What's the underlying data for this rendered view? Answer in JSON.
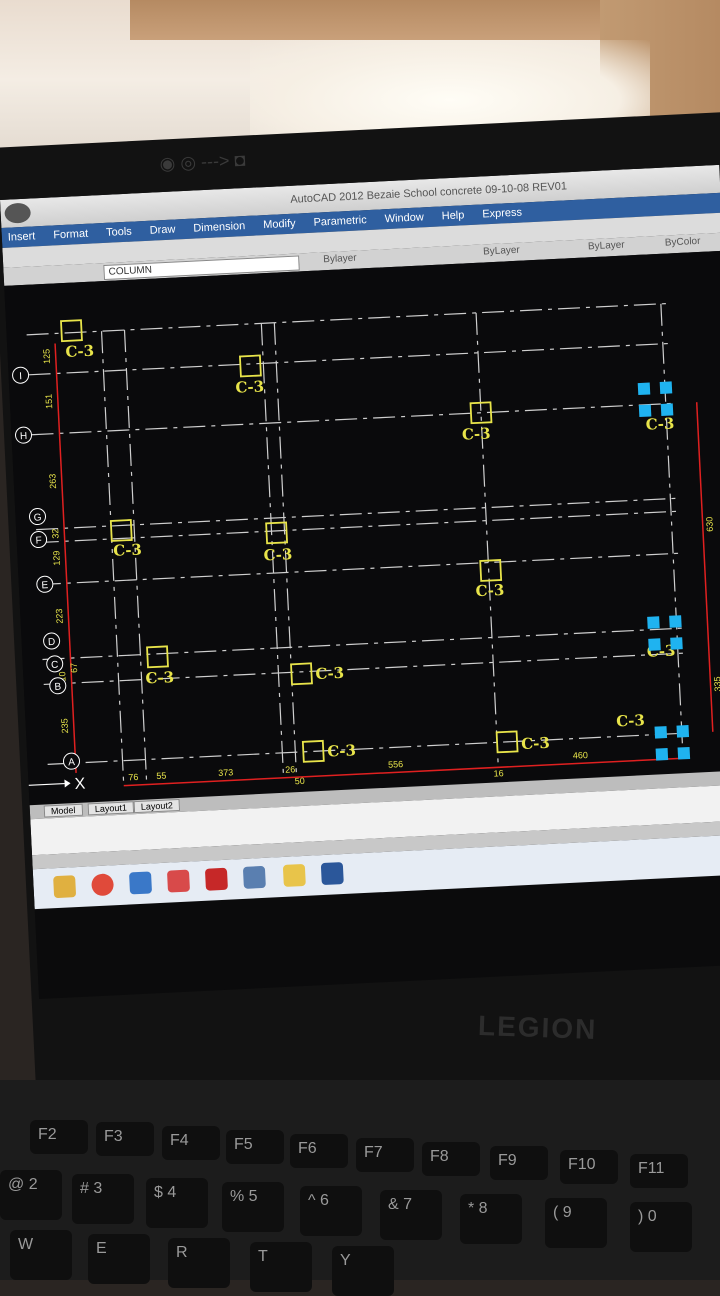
{
  "window": {
    "title": "AutoCAD 2012   Bezaie School concrete 09-10-08  REV01"
  },
  "menu": [
    "Insert",
    "Format",
    "Tools",
    "Draw",
    "Dimension",
    "Modify",
    "Parametric",
    "Window",
    "Help",
    "Express"
  ],
  "toolbar": {
    "layer": "COLUMN",
    "layer_prop": "Bylayer",
    "linetype": "ByLayer",
    "lineweight": "ByLayer",
    "color": "ByColor"
  },
  "tabs": [
    "Model",
    "Layout1",
    "Layout2"
  ],
  "axis": {
    "x_label": "X"
  },
  "grid_labels": [
    "I",
    "H",
    "G",
    "F",
    "E",
    "D",
    "C",
    "B",
    "A"
  ],
  "column_tag": "C-3",
  "dims_left": [
    "125",
    "151",
    "263",
    "32",
    "129",
    "223",
    "67",
    "10",
    "235"
  ],
  "dims_bottom": [
    "76",
    "55",
    "373",
    "26",
    "50",
    "556",
    "16",
    "460"
  ],
  "dims_right": [
    "630",
    "335"
  ],
  "brand": "LEGION",
  "fkeys": [
    "F2",
    "F3",
    "F4",
    "F5",
    "F6",
    "F7",
    "F8",
    "F9",
    "F10",
    "F11"
  ],
  "num_keys": [
    "@ 2",
    "# 3",
    "$ 4",
    "% 5",
    "^ 6",
    "& 7",
    "* 8",
    "( 9",
    ") 0"
  ],
  "letter_keys": [
    "W",
    "E",
    "R",
    "T",
    "Y"
  ]
}
